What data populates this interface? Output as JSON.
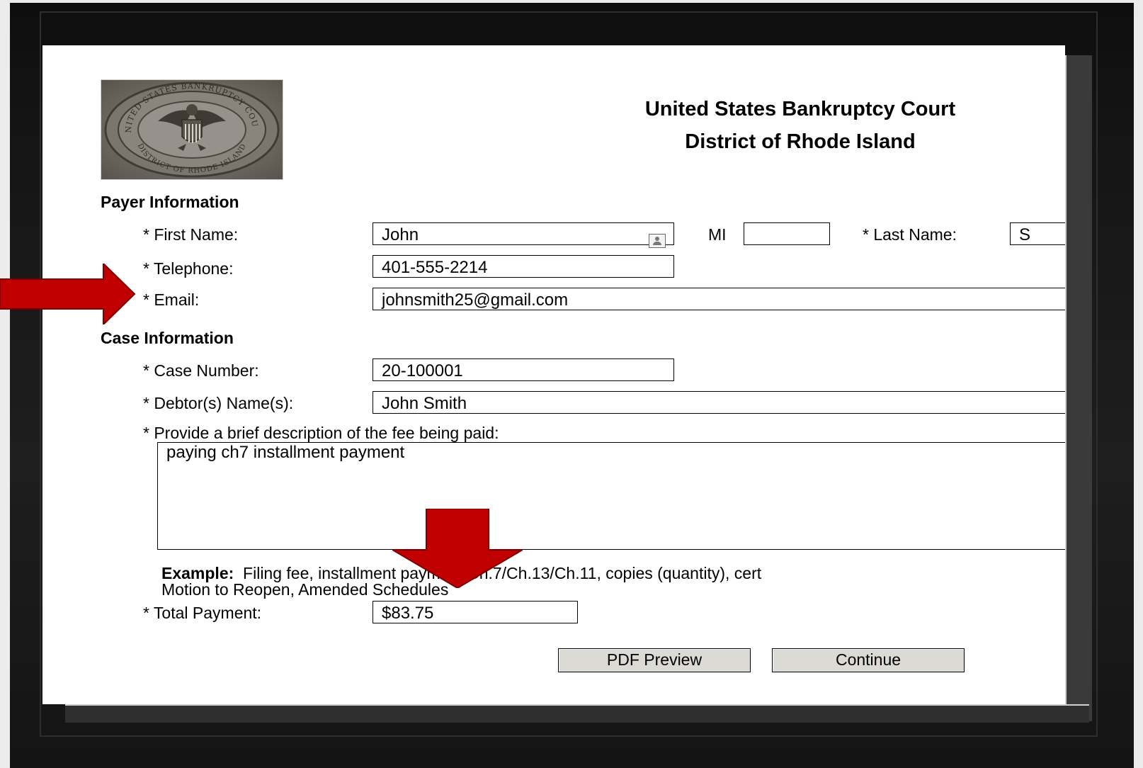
{
  "header": {
    "title": "United States Bankruptcy Court",
    "subtitle": "District of Rhode Island",
    "seal": {
      "top_text": "UNITED STATES BANKRUPTCY COURT",
      "bottom_text": "DISTRICT OF RHODE ISLAND"
    }
  },
  "payer": {
    "section_label": "Payer Information",
    "first_name_label": "* First Name:",
    "first_name_value": "John",
    "mi_label": "MI",
    "mi_value": "",
    "last_name_label": "* Last Name:",
    "last_name_value": "S",
    "telephone_label": "* Telephone:",
    "telephone_value": "401-555-2214",
    "email_label": "* Email:",
    "email_value": "johnsmith25@gmail.com"
  },
  "case": {
    "section_label": "Case Information",
    "case_number_label": "* Case Number:",
    "case_number_value": "20-100001",
    "debtor_label": "* Debtor(s) Name(s):",
    "debtor_value": "John Smith",
    "description_label": "* Provide a brief description of the fee being paid:",
    "description_value": "paying ch7 installment payment",
    "example_label": "Example:",
    "example_line1": "Filing fee, installment payment Ch.7/Ch.13/Ch.11, copies (quantity), cert",
    "example_line2": "Motion to Reopen, Amended Schedules",
    "total_label": "* Total Payment:",
    "total_value": "$83.75"
  },
  "buttons": {
    "pdf_preview": "PDF Preview",
    "continue": "Continue"
  },
  "colors": {
    "annotation_arrow": "#c00000",
    "frame": "#121212",
    "button_bg": "#dcdad5"
  }
}
